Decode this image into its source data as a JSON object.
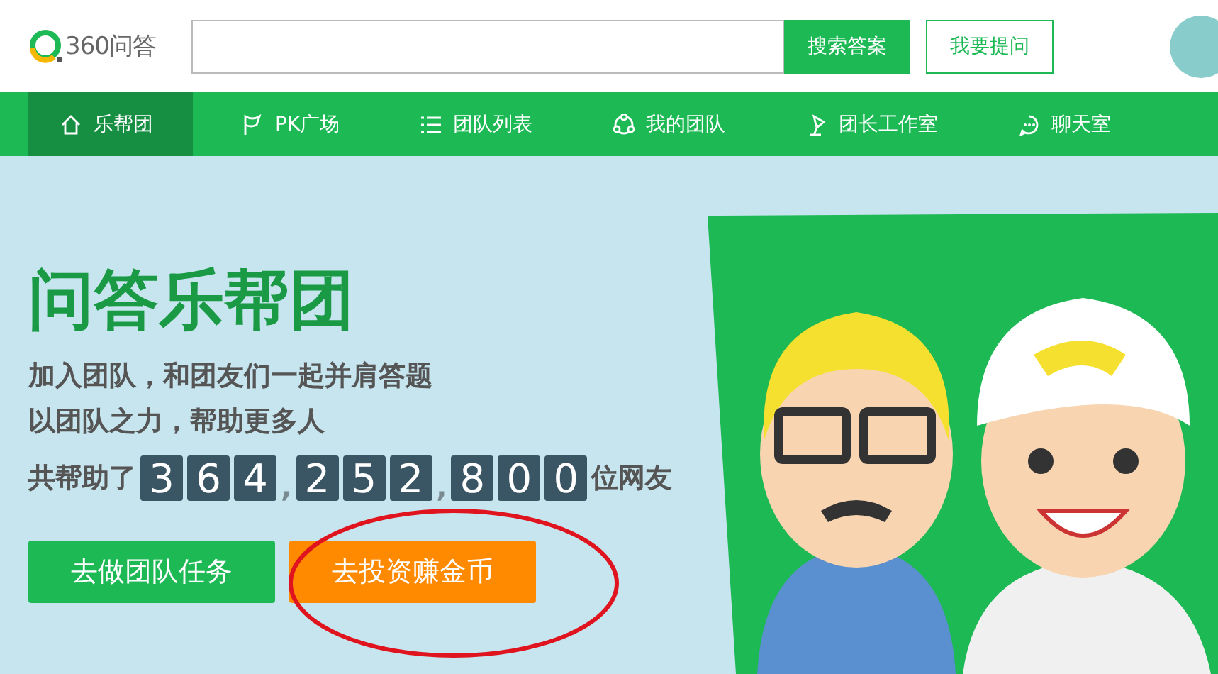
{
  "header": {
    "logo_text": "360问答",
    "search_button": "搜索答案",
    "ask_button": "我要提问"
  },
  "nav": [
    {
      "label": "乐帮团",
      "selected": true
    },
    {
      "label": "PK广场",
      "selected": false
    },
    {
      "label": "团队列表",
      "selected": false
    },
    {
      "label": "我的团队",
      "selected": false
    },
    {
      "label": "团长工作室",
      "selected": false
    },
    {
      "label": "聊天室",
      "selected": false
    }
  ],
  "hero": {
    "title": "问答乐帮团",
    "lines": [
      "加入团队，和团友们一起并肩答题",
      "以团队之力，帮助更多人"
    ],
    "counter": {
      "prefix": "共帮助了",
      "groups": [
        [
          "3",
          "6",
          "4"
        ],
        [
          "2",
          "5",
          "2"
        ],
        [
          "8",
          "0",
          "0"
        ]
      ],
      "separator": ",",
      "suffix": "位网友"
    },
    "buttons": [
      {
        "label": "去做团队任务",
        "kind": "green"
      },
      {
        "label": "去投资赚金币",
        "kind": "orange"
      }
    ]
  }
}
